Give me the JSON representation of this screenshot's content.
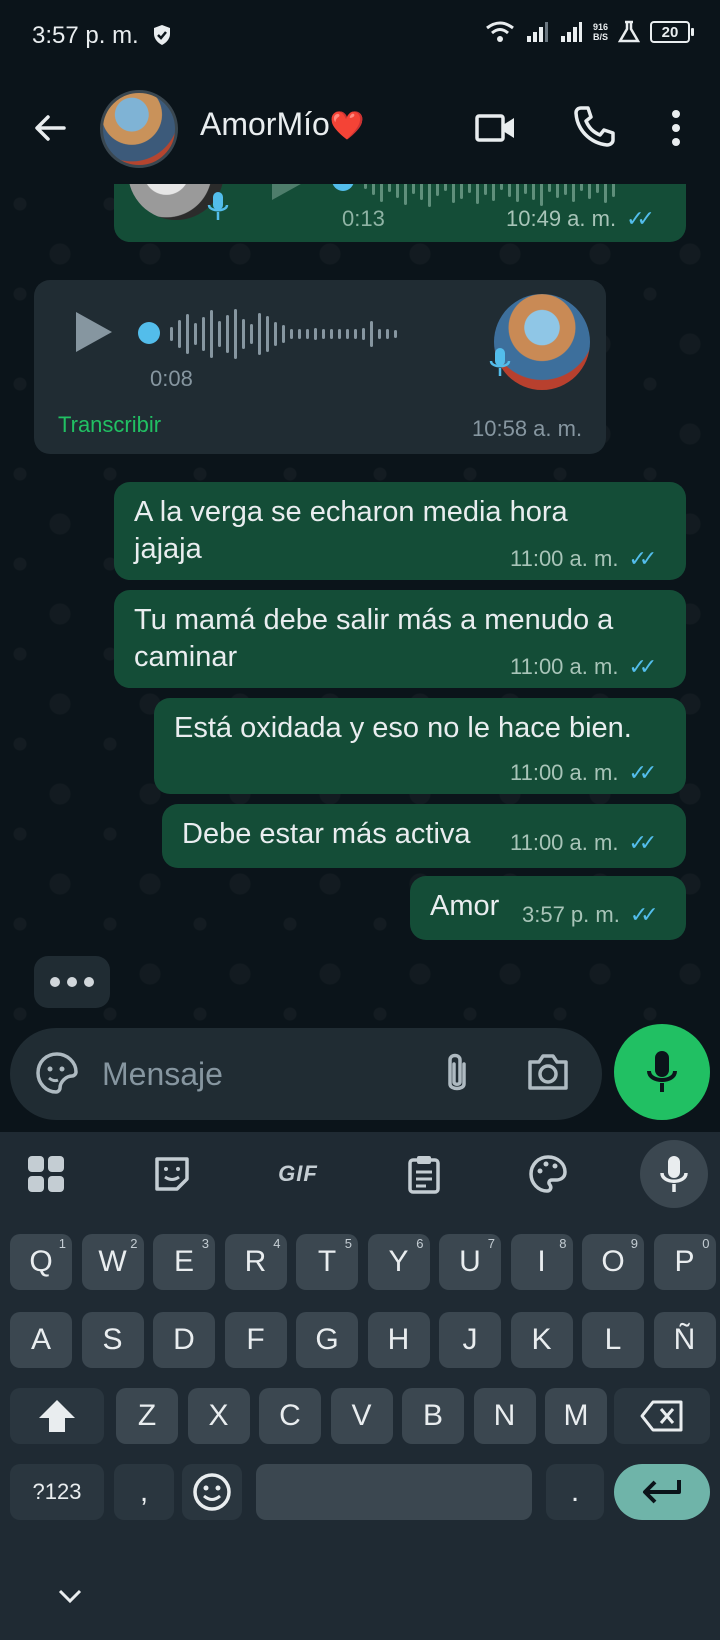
{
  "status_bar": {
    "time": "3:57 p. m.",
    "net_speed_value": "916",
    "net_speed_unit": "B/S",
    "battery": "20"
  },
  "header": {
    "back_icon": "arrow-left-icon",
    "contact_name": "AmorMío",
    "contact_emoji": "❤️",
    "video_icon": "video-camera-icon",
    "call_icon": "phone-icon",
    "menu_icon": "more-vert-icon"
  },
  "messages": [
    {
      "type": "voice",
      "direction": "out",
      "duration": "0:13",
      "time": "10:49 a. m.",
      "read": true
    },
    {
      "type": "voice",
      "direction": "in",
      "duration": "0:08",
      "time": "10:58 a. m.",
      "transcribe_label": "Transcribir"
    },
    {
      "type": "text",
      "direction": "out",
      "text": "A la verga se echaron media hora jajaja",
      "time": "11:00 a. m.",
      "read": true
    },
    {
      "type": "text",
      "direction": "out",
      "text": "Tu mamá debe salir más a menudo a caminar",
      "time": "11:00 a. m.",
      "read": true
    },
    {
      "type": "text",
      "direction": "out",
      "text": "Está oxidada y eso no le hace bien.",
      "time": "11:00 a. m.",
      "read": true
    },
    {
      "type": "text",
      "direction": "out",
      "text": "Debe estar más activa",
      "time": "11:00 a. m.",
      "read": true
    },
    {
      "type": "text",
      "direction": "out",
      "text": "Amor",
      "time": "3:57 p. m.",
      "read": true
    }
  ],
  "composer": {
    "placeholder": "Mensaje",
    "value": ""
  },
  "keyboard": {
    "toolbar": {
      "gif_label": "GIF"
    },
    "row1": [
      {
        "k": "Q",
        "s": "1"
      },
      {
        "k": "W",
        "s": "2"
      },
      {
        "k": "E",
        "s": "3"
      },
      {
        "k": "R",
        "s": "4"
      },
      {
        "k": "T",
        "s": "5"
      },
      {
        "k": "Y",
        "s": "6"
      },
      {
        "k": "U",
        "s": "7"
      },
      {
        "k": "I",
        "s": "8"
      },
      {
        "k": "O",
        "s": "9"
      },
      {
        "k": "P",
        "s": "0"
      }
    ],
    "row2": [
      "A",
      "S",
      "D",
      "F",
      "G",
      "H",
      "J",
      "K",
      "L",
      "Ñ"
    ],
    "row3": [
      "Z",
      "X",
      "C",
      "V",
      "B",
      "N",
      "M"
    ],
    "symbols_label": "?123",
    "comma_label": ",",
    "period_label": "."
  },
  "colors": {
    "background": "#0b141a",
    "outgoing_bubble": "#144d37",
    "incoming_bubble": "#202c33",
    "accent_green": "#21c063",
    "read_ticks": "#53bdeb"
  }
}
